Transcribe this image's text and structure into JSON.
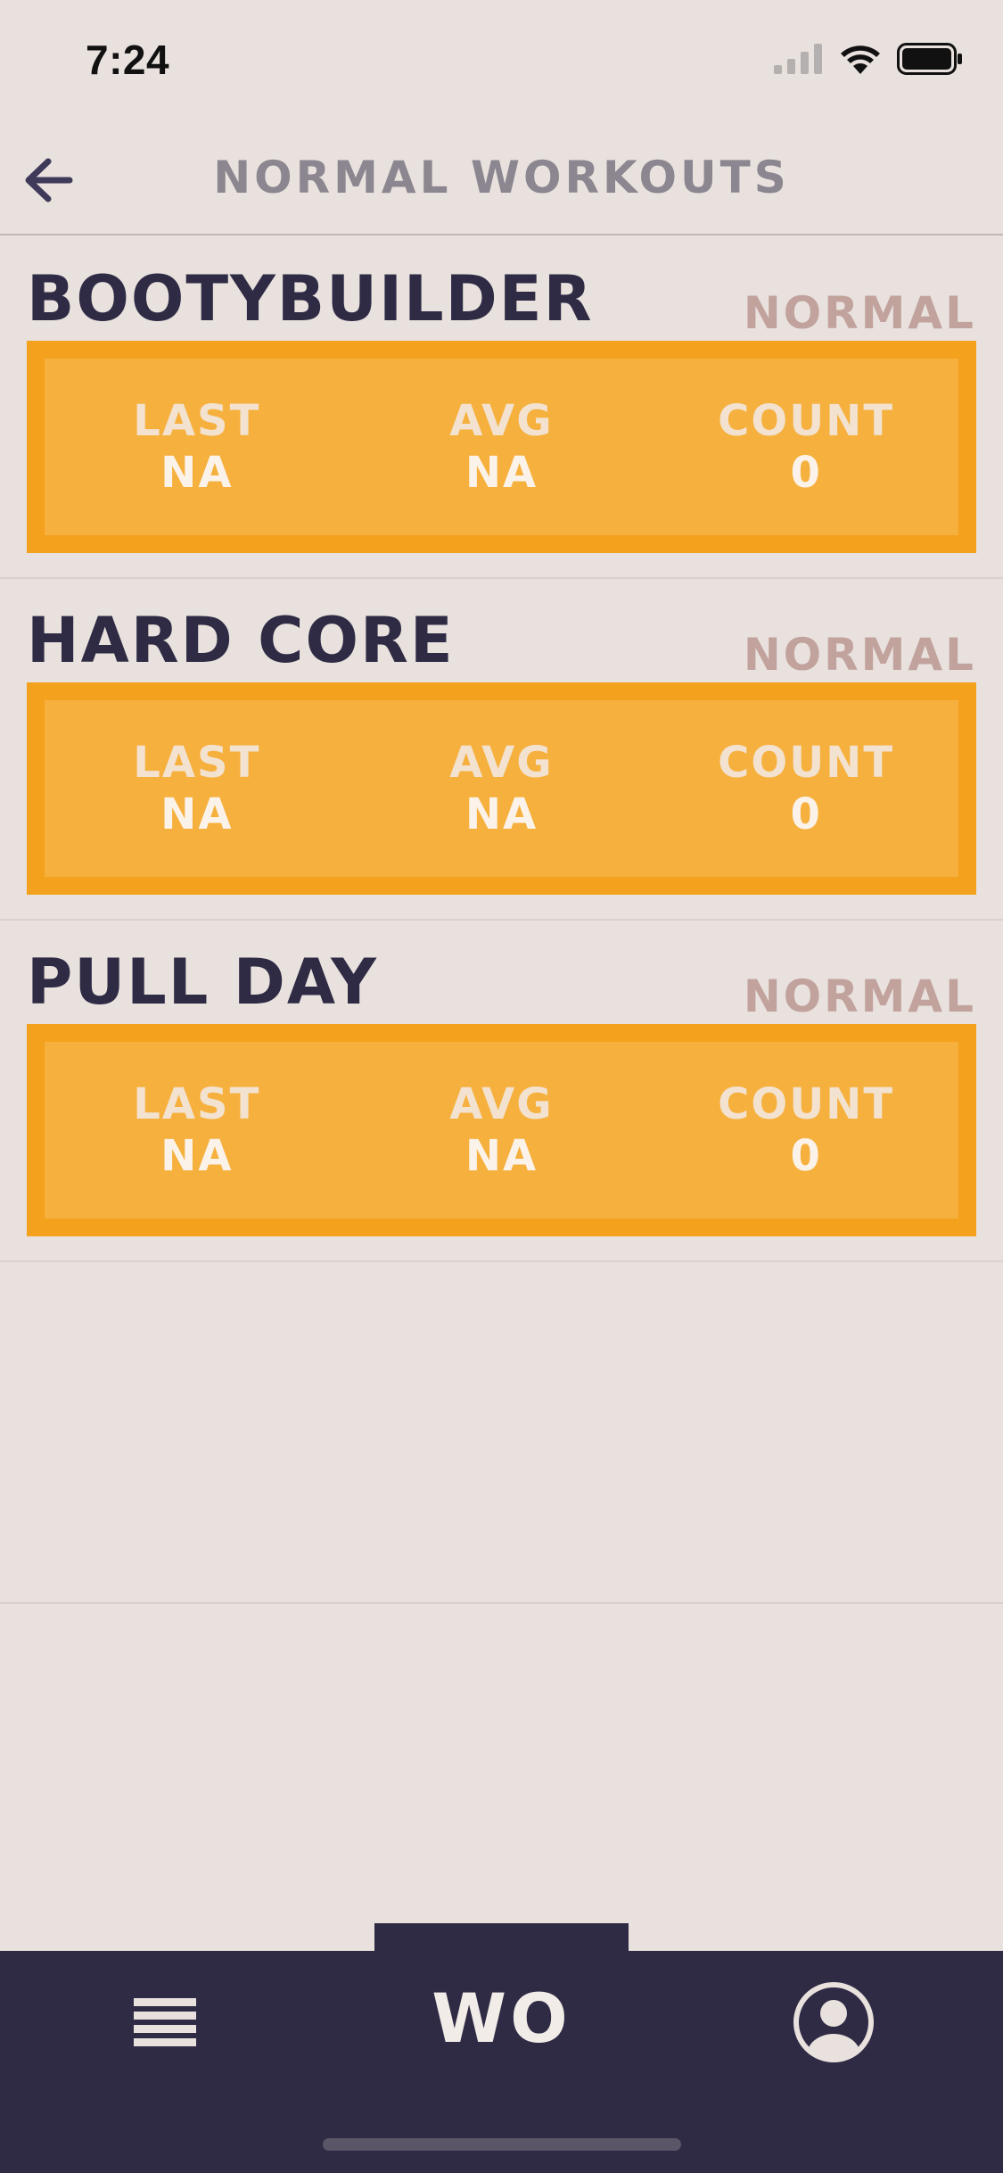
{
  "status_bar": {
    "time": "7:24",
    "icons": [
      "cellular-signal-icon",
      "wifi-icon",
      "battery-icon"
    ]
  },
  "header": {
    "back_icon": "arrow-left-icon",
    "title": "NORMAL WORKOUTS"
  },
  "workouts": [
    {
      "name": "BOOTYBUILDER",
      "tag": "NORMAL",
      "stats": {
        "last_label": "LAST",
        "last_value": "NA",
        "avg_label": "AVG",
        "avg_value": "NA",
        "count_label": "COUNT",
        "count_value": "0"
      }
    },
    {
      "name": "HARD CORE",
      "tag": "NORMAL",
      "stats": {
        "last_label": "LAST",
        "last_value": "NA",
        "avg_label": "AVG",
        "avg_value": "NA",
        "count_label": "COUNT",
        "count_value": "0"
      }
    },
    {
      "name": "PULL DAY",
      "tag": "NORMAL",
      "stats": {
        "last_label": "LAST",
        "last_value": "NA",
        "avg_label": "AVG",
        "avg_value": "NA",
        "count_label": "COUNT",
        "count_value": "0"
      }
    }
  ],
  "tab_bar": {
    "menu_icon": "hamburger-menu-icon",
    "center_label": "WO",
    "profile_icon": "user-profile-icon"
  },
  "colors": {
    "background": "#E8E1DD",
    "accent": "#F4A11E",
    "accent_inner": "#F6B03E",
    "dark": "#302B45",
    "tag": "#C2A29D"
  }
}
